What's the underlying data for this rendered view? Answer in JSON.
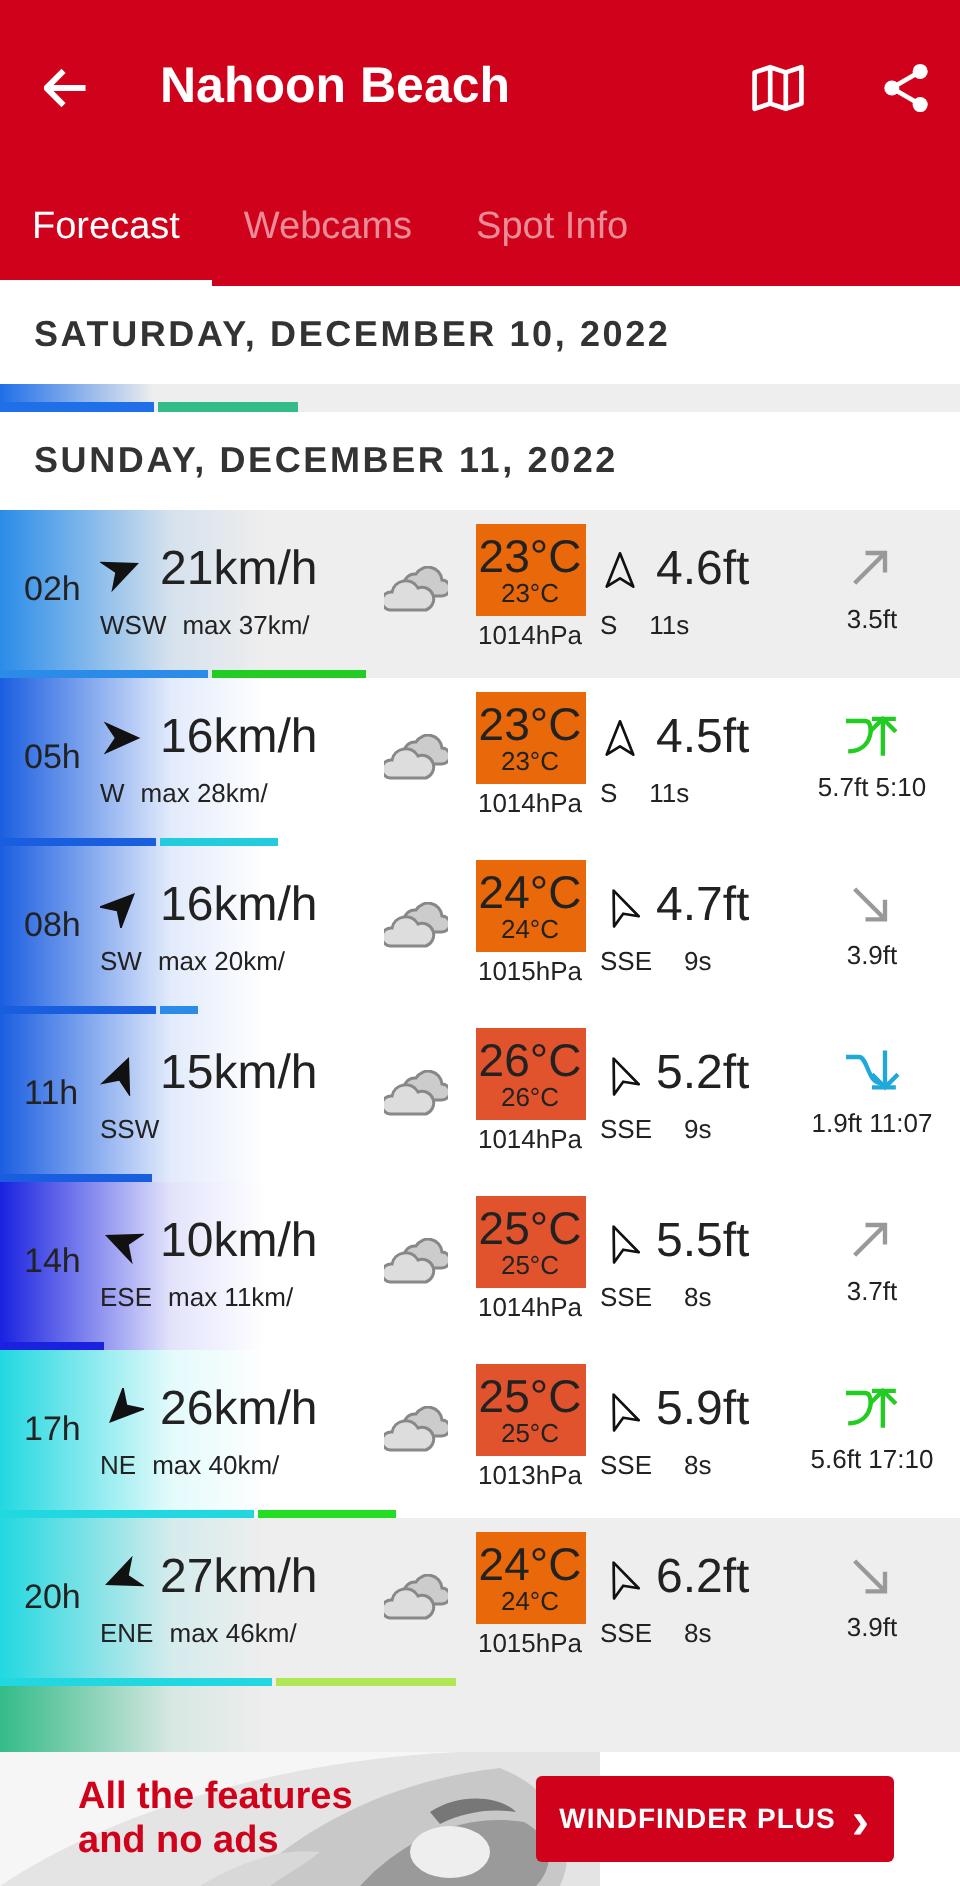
{
  "header": {
    "title": "Nahoon Beach"
  },
  "tabs": [
    {
      "label": "Forecast",
      "selected": true
    },
    {
      "label": "Webcams",
      "selected": false
    },
    {
      "label": "Spot Info",
      "selected": false
    }
  ],
  "days": [
    {
      "date": "SATURDAY, DECEMBER 10, 2022",
      "summary": {
        "wind_bar": {
          "color": "#1f6fe8",
          "level": 0.16
        },
        "gust_bar": {
          "color": "#33bb88",
          "level": 0.174
        }
      }
    },
    {
      "date": "SUNDAY, DECEMBER 11, 2022",
      "rows": [
        {
          "hour": "02h",
          "shaded": true,
          "wind": {
            "speed": "21km/h",
            "dir": "WSW",
            "gust": "max 37km/",
            "color": "#2a8ce8",
            "level": 0.217
          },
          "gust_bar": {
            "color": "#22cc22"
          },
          "temp": {
            "air": "23°C",
            "feels": "23°C",
            "color": "#e8680a"
          },
          "pressure": "1014hPa",
          "swell": {
            "height": "4.6ft",
            "dir": "S",
            "period": "11s"
          },
          "tide": {
            "kind": "rising",
            "text": "3.5ft"
          }
        },
        {
          "hour": "05h",
          "shaded": false,
          "wind": {
            "speed": "16km/h",
            "dir": "W",
            "gust": "max 28km/",
            "color": "#1a5ee0",
            "level": 0.163
          },
          "gust_bar": {
            "color": "#22ccdd"
          },
          "temp": {
            "air": "23°C",
            "feels": "23°C",
            "color": "#e8680a"
          },
          "pressure": "1014hPa",
          "swell": {
            "height": "4.5ft",
            "dir": "S",
            "period": "11s"
          },
          "tide": {
            "kind": "high",
            "text": "5.7ft 5:10"
          }
        },
        {
          "hour": "08h",
          "shaded": false,
          "wind": {
            "speed": "16km/h",
            "dir": "SW",
            "gust": "max 20km/",
            "color": "#1a5ee0",
            "level": 0.163
          },
          "gust_bar": {
            "color": "#2a8ce8"
          },
          "temp": {
            "air": "24°C",
            "feels": "24°C",
            "color": "#e8680a"
          },
          "pressure": "1015hPa",
          "swell": {
            "height": "4.7ft",
            "dir": "SSE",
            "period": "9s"
          },
          "tide": {
            "kind": "falling",
            "text": "3.9ft"
          }
        },
        {
          "hour": "11h",
          "shaded": false,
          "wind": {
            "speed": "15km/h",
            "dir": "SSW",
            "color": "#1a5ee0",
            "level": 0.158
          },
          "temp": {
            "air": "26°C",
            "feels": "26°C",
            "color": "#e0532c"
          },
          "pressure": "1014hPa",
          "swell": {
            "height": "5.2ft",
            "dir": "SSE",
            "period": "9s"
          },
          "tide": {
            "kind": "low",
            "text": "1.9ft 11:07"
          }
        },
        {
          "hour": "14h",
          "shaded": false,
          "wind": {
            "speed": "10km/h",
            "dir": "ESE",
            "gust": "max 11km/",
            "color": "#1a22e0",
            "level": 0.108
          },
          "temp": {
            "air": "25°C",
            "feels": "25°C",
            "color": "#e0532c"
          },
          "pressure": "1014hPa",
          "swell": {
            "height": "5.5ft",
            "dir": "SSE",
            "period": "8s"
          },
          "tide": {
            "kind": "rising",
            "text": "3.7ft"
          }
        },
        {
          "hour": "17h",
          "shaded": false,
          "wind": {
            "speed": "26km/h",
            "dir": "NE",
            "gust": "max 40km/",
            "color": "#22d8e0",
            "level": 0.265
          },
          "gust_bar": {
            "color": "#22dd22"
          },
          "temp": {
            "air": "25°C",
            "feels": "25°C",
            "color": "#e0532c"
          },
          "pressure": "1013hPa",
          "swell": {
            "height": "5.9ft",
            "dir": "SSE",
            "period": "8s"
          },
          "tide": {
            "kind": "high",
            "text": "5.6ft 17:10"
          }
        },
        {
          "hour": "20h",
          "shaded": true,
          "wind": {
            "speed": "27km/h",
            "dir": "ENE",
            "gust": "max 46km/",
            "color": "#22d8e0",
            "level": 0.283
          },
          "gust_bar": {
            "color": "#b0e855"
          },
          "temp": {
            "air": "24°C",
            "feels": "24°C",
            "color": "#e8680a"
          },
          "pressure": "1015hPa",
          "swell": {
            "height": "6.2ft",
            "dir": "SSE",
            "period": "8s"
          },
          "tide": {
            "kind": "falling",
            "text": "3.9ft"
          }
        },
        {
          "shaded": true,
          "wind": {
            "color": "#33bb88"
          }
        }
      ]
    }
  ],
  "ad": {
    "text": "All the features and no ads",
    "button": "WINDFINDER PLUS",
    "button_icon": "›"
  }
}
